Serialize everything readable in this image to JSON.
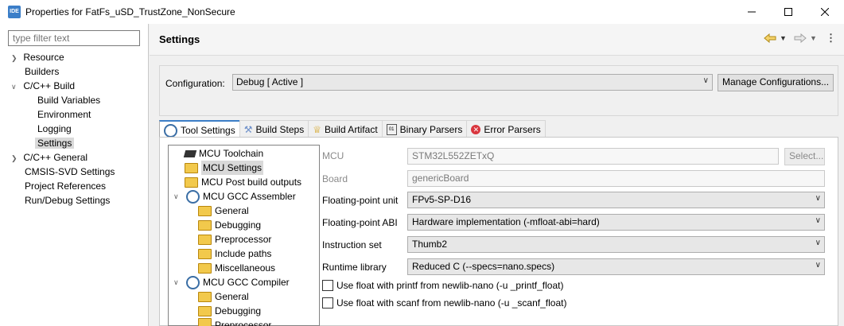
{
  "window": {
    "app_badge": "IDE",
    "title": "Properties for FatFs_uSD_TrustZone_NonSecure"
  },
  "filter": {
    "placeholder": "type filter text"
  },
  "nav_tree": [
    {
      "label": "Resource",
      "expandable": true
    },
    {
      "label": "Builders",
      "expandable": false
    },
    {
      "label": "C/C++ Build",
      "expanded": true
    },
    {
      "label": "Build Variables",
      "child": true
    },
    {
      "label": "Environment",
      "child": true
    },
    {
      "label": "Logging",
      "child": true
    },
    {
      "label": "Settings",
      "child": true,
      "selected": true
    },
    {
      "label": "C/C++ General",
      "expandable": true
    },
    {
      "label": "CMSIS-SVD Settings"
    },
    {
      "label": "Project References"
    },
    {
      "label": "Run/Debug Settings"
    }
  ],
  "header": {
    "title": "Settings"
  },
  "config": {
    "label": "Configuration:",
    "value": "Debug  [ Active ]",
    "manage_button": "Manage Configurations..."
  },
  "tabs": [
    {
      "label": "Tool Settings",
      "active": true
    },
    {
      "label": "Build Steps"
    },
    {
      "label": "Build Artifact"
    },
    {
      "label": "Binary Parsers"
    },
    {
      "label": "Error Parsers"
    }
  ],
  "tool_tree": [
    {
      "label": "MCU Toolchain",
      "icon": "chip-icon"
    },
    {
      "label": "MCU Settings",
      "icon": "folder-icon",
      "selected": true
    },
    {
      "label": "MCU Post build outputs",
      "icon": "folder-icon"
    },
    {
      "label": "MCU GCC Assembler",
      "icon": "gear-icon",
      "expanded": true
    },
    {
      "label": "General",
      "icon": "folder-icon"
    },
    {
      "label": "Debugging",
      "icon": "folder-icon"
    },
    {
      "label": "Preprocessor",
      "icon": "folder-icon"
    },
    {
      "label": "Include paths",
      "icon": "folder-icon"
    },
    {
      "label": "Miscellaneous",
      "icon": "folder-icon"
    },
    {
      "label": "MCU GCC Compiler",
      "icon": "gear-icon",
      "expanded": true
    },
    {
      "label": "General",
      "icon": "folder-icon"
    },
    {
      "label": "Debugging",
      "icon": "folder-icon"
    },
    {
      "label": "Preprocessor",
      "icon": "folder-icon"
    }
  ],
  "form": {
    "mcu_label": "MCU",
    "mcu_value": "STM32L552ZETxQ",
    "select_button": "Select...",
    "board_label": "Board",
    "board_value": "genericBoard",
    "fpu_label": "Floating-point unit",
    "fpu_value": "FPv5-SP-D16",
    "abi_label": "Floating-point ABI",
    "abi_value": "Hardware implementation (-mfloat-abi=hard)",
    "iset_label": "Instruction set",
    "iset_value": "Thumb2",
    "runtime_label": "Runtime library",
    "runtime_value": "Reduced C (--specs=nano.specs)",
    "printf_float": "Use float with printf from newlib-nano (-u _printf_float)",
    "scanf_float": "Use float with scanf from newlib-nano (-u _scanf_float)"
  },
  "colors": {
    "accent": "#3c7ec7",
    "selection": "#d9d9d9",
    "tab_active_border": "#3c7ec7"
  }
}
